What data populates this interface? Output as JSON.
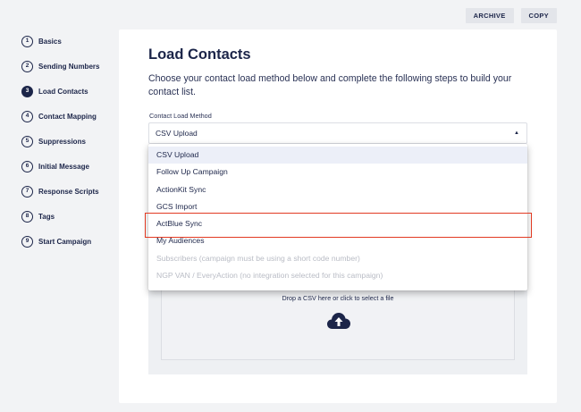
{
  "header": {
    "archive_label": "ARCHIVE",
    "copy_label": "COPY"
  },
  "steps": [
    {
      "num": "1",
      "label": "Basics"
    },
    {
      "num": "2",
      "label": "Sending Numbers"
    },
    {
      "num": "3",
      "label": "Load Contacts",
      "active": true
    },
    {
      "num": "4",
      "label": "Contact Mapping"
    },
    {
      "num": "5",
      "label": "Suppressions"
    },
    {
      "num": "6",
      "label": "Initial Message"
    },
    {
      "num": "7",
      "label": "Response Scripts"
    },
    {
      "num": "8",
      "label": "Tags"
    },
    {
      "num": "9",
      "label": "Start Campaign"
    }
  ],
  "main": {
    "title": "Load Contacts",
    "description": "Choose your contact load method below and complete the following steps to build your contact list.",
    "field_label": "Contact Load Method",
    "select_value": "CSV Upload",
    "options": [
      {
        "label": "CSV Upload",
        "selected": true
      },
      {
        "label": "Follow Up Campaign"
      },
      {
        "label": "ActionKit Sync"
      },
      {
        "label": "GCS Import"
      },
      {
        "label": "ActBlue Sync",
        "highlighted": true
      },
      {
        "label": "My Audiences"
      },
      {
        "label": "Subscribers (campaign must be using a short code number)",
        "disabled": true
      },
      {
        "label": "NGP VAN / EveryAction (no integration selected for this campaign)",
        "disabled": true
      }
    ],
    "upload_text": "Drop a CSV here or click to select a file"
  },
  "colors": {
    "primary": "#1c2549",
    "highlight": "#e23a22",
    "background": "#f2f3f5"
  }
}
